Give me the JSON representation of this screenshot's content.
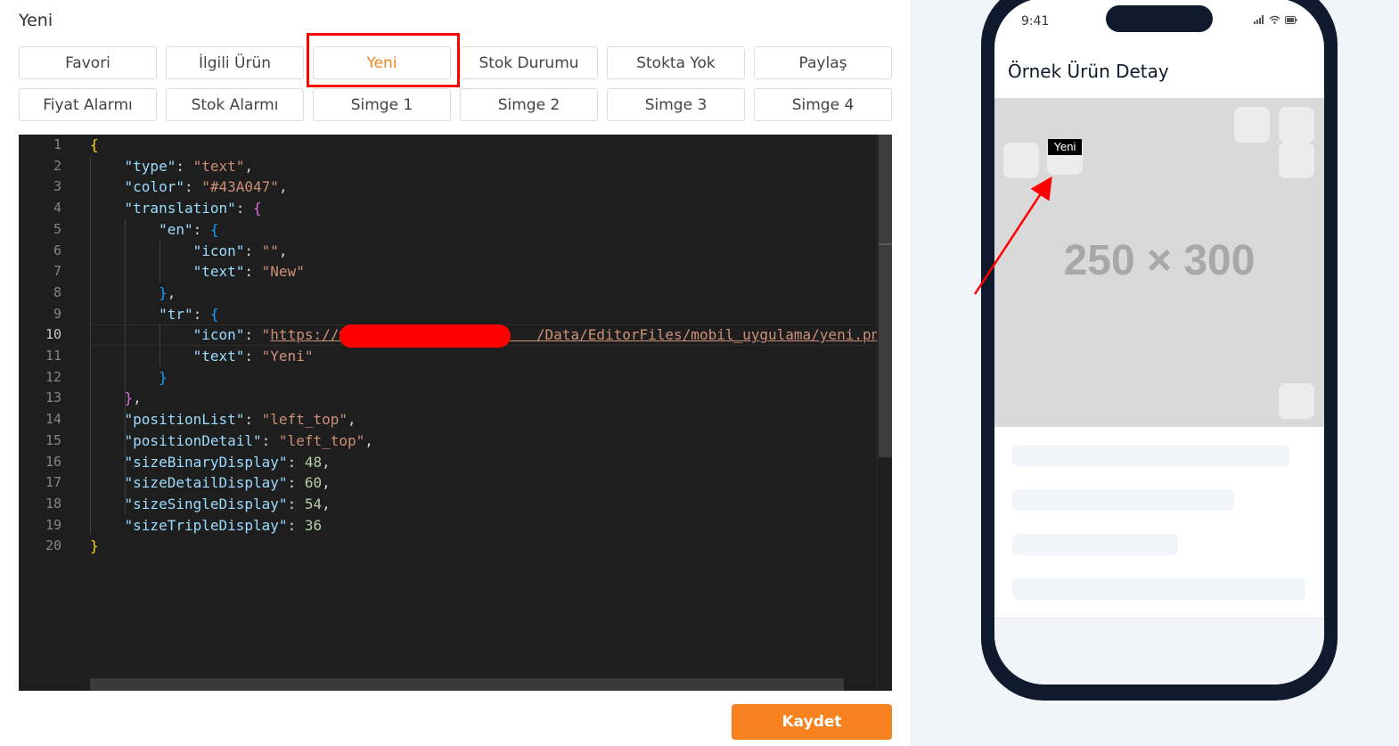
{
  "left": {
    "title": "Yeni",
    "buttons": [
      {
        "label": "Favori",
        "active": false
      },
      {
        "label": "İlgili Ürün",
        "active": false
      },
      {
        "label": "Yeni",
        "active": true
      },
      {
        "label": "Stok Durumu",
        "active": false
      },
      {
        "label": "Stokta Yok",
        "active": false
      },
      {
        "label": "Paylaş",
        "active": false
      },
      {
        "label": "Fiyat Alarmı",
        "active": false
      },
      {
        "label": "Stok Alarmı",
        "active": false
      },
      {
        "label": "Simge 1",
        "active": false
      },
      {
        "label": "Simge 2",
        "active": false
      },
      {
        "label": "Simge 3",
        "active": false
      },
      {
        "label": "Simge 4",
        "active": false
      }
    ],
    "save_label": "Kaydet",
    "accent_color": "#f5821f"
  },
  "editor": {
    "current_line": 10,
    "lines": [
      [
        [
          "b1",
          "{"
        ]
      ],
      [
        [
          "p",
          "    "
        ],
        [
          "k",
          "\"type\""
        ],
        [
          "p",
          ": "
        ],
        [
          "s",
          "\"text\""
        ],
        [
          "p",
          ","
        ]
      ],
      [
        [
          "p",
          "    "
        ],
        [
          "k",
          "\"color\""
        ],
        [
          "p",
          ": "
        ],
        [
          "s",
          "\"#43A047\""
        ],
        [
          "p",
          ","
        ]
      ],
      [
        [
          "p",
          "    "
        ],
        [
          "k",
          "\"translation\""
        ],
        [
          "p",
          ": "
        ],
        [
          "b2",
          "{"
        ]
      ],
      [
        [
          "p",
          "        "
        ],
        [
          "k",
          "\"en\""
        ],
        [
          "p",
          ": "
        ],
        [
          "b3",
          "{"
        ]
      ],
      [
        [
          "p",
          "            "
        ],
        [
          "k",
          "\"icon\""
        ],
        [
          "p",
          ": "
        ],
        [
          "s",
          "\"\""
        ],
        [
          "p",
          ","
        ]
      ],
      [
        [
          "p",
          "            "
        ],
        [
          "k",
          "\"text\""
        ],
        [
          "p",
          ": "
        ],
        [
          "s",
          "\"New\""
        ]
      ],
      [
        [
          "p",
          "        "
        ],
        [
          "b3",
          "}"
        ],
        [
          "p",
          ","
        ]
      ],
      [
        [
          "p",
          "        "
        ],
        [
          "k",
          "\"tr\""
        ],
        [
          "p",
          ": "
        ],
        [
          "b3",
          "{"
        ]
      ],
      [
        [
          "p",
          "            "
        ],
        [
          "k",
          "\"icon\""
        ],
        [
          "p",
          ": "
        ],
        [
          "s",
          "\""
        ],
        [
          "u",
          "https://m                      /Data/EditorFiles/mobil_uygulama/yeni.png"
        ],
        [
          "s",
          "\""
        ],
        [
          "p",
          ","
        ]
      ],
      [
        [
          "p",
          "            "
        ],
        [
          "k",
          "\"text\""
        ],
        [
          "p",
          ": "
        ],
        [
          "s",
          "\"Yeni\""
        ]
      ],
      [
        [
          "p",
          "        "
        ],
        [
          "b3",
          "}"
        ]
      ],
      [
        [
          "p",
          "    "
        ],
        [
          "b2",
          "}"
        ],
        [
          "p",
          ","
        ]
      ],
      [
        [
          "p",
          "    "
        ],
        [
          "k",
          "\"positionList\""
        ],
        [
          "p",
          ": "
        ],
        [
          "s",
          "\"left_top\""
        ],
        [
          "p",
          ","
        ]
      ],
      [
        [
          "p",
          "    "
        ],
        [
          "k",
          "\"positionDetail\""
        ],
        [
          "p",
          ": "
        ],
        [
          "s",
          "\"left_top\""
        ],
        [
          "p",
          ","
        ]
      ],
      [
        [
          "p",
          "    "
        ],
        [
          "k",
          "\"sizeBinaryDisplay\""
        ],
        [
          "p",
          ": "
        ],
        [
          "n",
          "48"
        ],
        [
          "p",
          ","
        ]
      ],
      [
        [
          "p",
          "    "
        ],
        [
          "k",
          "\"sizeDetailDisplay\""
        ],
        [
          "p",
          ": "
        ],
        [
          "n",
          "60"
        ],
        [
          "p",
          ","
        ]
      ],
      [
        [
          "p",
          "    "
        ],
        [
          "k",
          "\"sizeSingleDisplay\""
        ],
        [
          "p",
          ": "
        ],
        [
          "n",
          "54"
        ],
        [
          "p",
          ","
        ]
      ],
      [
        [
          "p",
          "    "
        ],
        [
          "k",
          "\"sizeTripleDisplay\""
        ],
        [
          "p",
          ": "
        ],
        [
          "n",
          "36"
        ]
      ],
      [
        [
          "b1",
          "}"
        ]
      ]
    ]
  },
  "phone": {
    "time": "9:41",
    "screen_title": "Örnek Ürün Detay",
    "image_placeholder": "250 × 300",
    "badge_text": "Yeni"
  }
}
